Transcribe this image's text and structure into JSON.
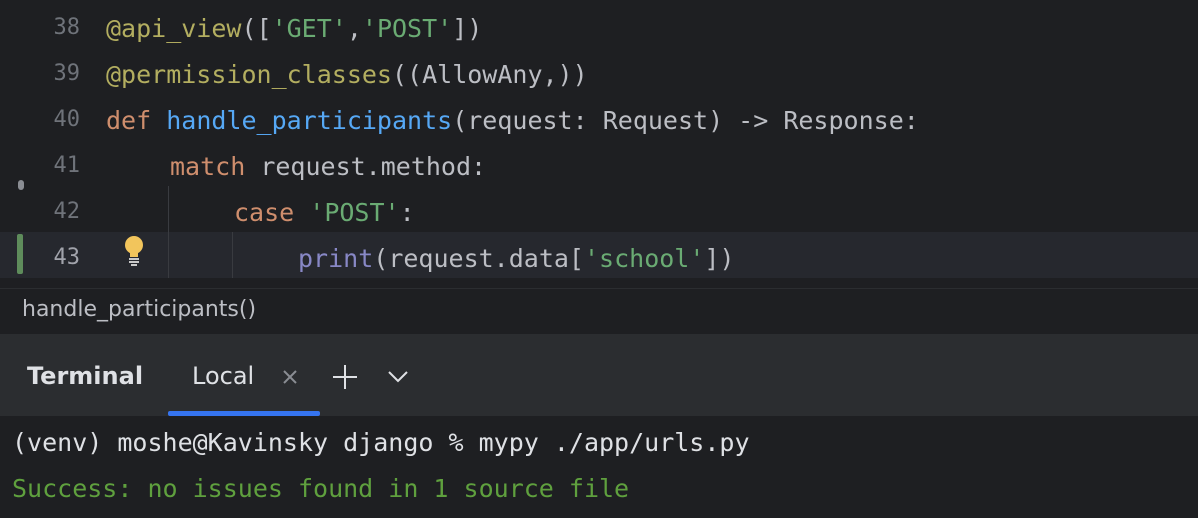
{
  "editor": {
    "lines": [
      {
        "number": "38",
        "tokens": {
          "a": "@api_view",
          "b": "([",
          "c": "'GET'",
          "d": ",",
          "e": "'POST'",
          "f": "])"
        }
      },
      {
        "number": "39",
        "tokens": {
          "a": "@permission_classes",
          "b": "((AllowAny,))"
        }
      },
      {
        "number": "40",
        "tokens": {
          "a": "def",
          "b": " ",
          "c": "handle_participants",
          "d": "(request: Request) -> Response:"
        }
      },
      {
        "number": "41",
        "tokens": {
          "a": "match",
          "b": " request.method:"
        }
      },
      {
        "number": "42",
        "tokens": {
          "a": "case",
          "b": " ",
          "c": "'POST'",
          "d": ":"
        }
      },
      {
        "number": "43",
        "tokens": {
          "a": "print",
          "b": "(request.data[",
          "c": "'school'",
          "d": "])"
        }
      }
    ]
  },
  "breadcrumb": {
    "label": "handle_participants()"
  },
  "terminal": {
    "title": "Terminal",
    "tab_label": "Local",
    "command": "(venv) moshe@Kavinsky django % mypy ./app/urls.py",
    "output": "Success: no issues found in 1 source file"
  },
  "icons": {
    "bulb": "lightbulb-icon",
    "close": "close-icon",
    "add": "plus-icon",
    "dropdown": "chevron-down-icon"
  },
  "colors": {
    "background": "#1e1f22",
    "keyword": "#cf8e6d",
    "decorator": "#b3ae60",
    "function": "#56a8f5",
    "string": "#6aab73",
    "builtin": "#8888c6",
    "success": "#5fa03e",
    "accent": "#3574f0"
  }
}
